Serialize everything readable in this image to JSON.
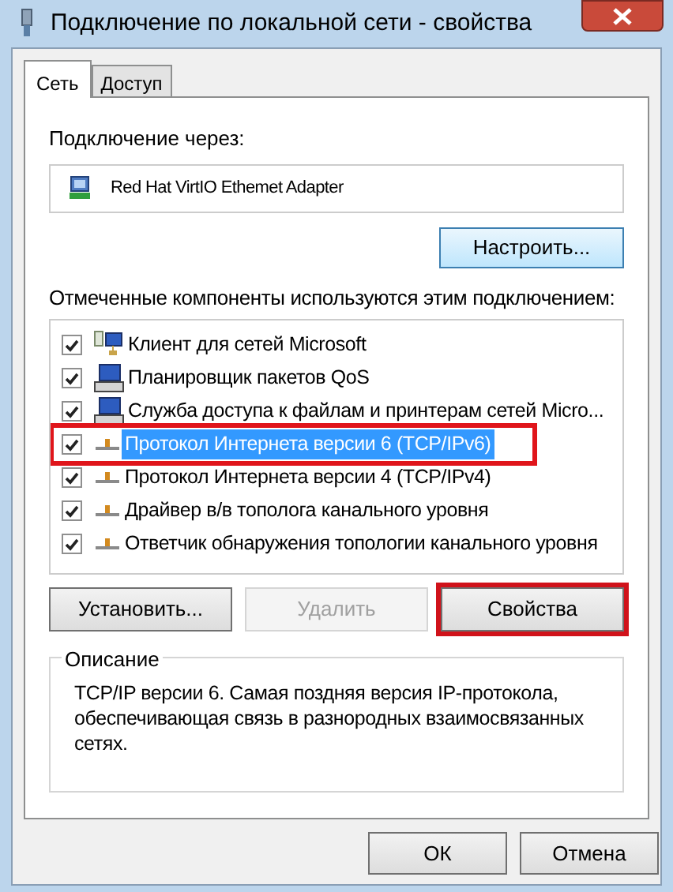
{
  "window": {
    "title": "Подключение по локальной сети - свойства"
  },
  "tabs": [
    {
      "label": "Сеть",
      "selected": true
    },
    {
      "label": "Доступ",
      "selected": false
    }
  ],
  "connect_label": "Подключение через:",
  "adapter": "Red Hat VirtIO Ethemet Adapter",
  "configure_button": "Настроить...",
  "components_label": "Отмеченные компоненты используются этим подключением:",
  "components": [
    {
      "kind": "client",
      "label": "Клиент для сетей Microsoft",
      "checked": true,
      "selected": false,
      "highlighted": false
    },
    {
      "kind": "service",
      "label": "Планировщик пакетов QoS",
      "checked": true,
      "selected": false,
      "highlighted": false
    },
    {
      "kind": "service",
      "label": "Служба доступа к файлам и принтерам сетей Micro...",
      "checked": true,
      "selected": false,
      "highlighted": false
    },
    {
      "kind": "protocol",
      "label": "Протокол Интернета версии 6 (TCP/IPv6)",
      "checked": true,
      "selected": true,
      "highlighted": true
    },
    {
      "kind": "protocol",
      "label": "Протокол Интернета версии 4 (TCP/IPv4)",
      "checked": true,
      "selected": false,
      "highlighted": false
    },
    {
      "kind": "protocol",
      "label": "Драйвер в/в тополога канального уровня",
      "checked": true,
      "selected": false,
      "highlighted": false
    },
    {
      "kind": "protocol",
      "label": "Ответчик обнаружения топологии канального уровня",
      "checked": true,
      "selected": false,
      "highlighted": false
    }
  ],
  "actions": [
    {
      "label": "Установить...",
      "disabled": false,
      "highlighted": false
    },
    {
      "label": "Удалить",
      "disabled": true,
      "highlighted": false
    },
    {
      "label": "Свойства",
      "disabled": false,
      "highlighted": true
    }
  ],
  "description": {
    "title": "Описание",
    "text": "TCP/IP версии 6. Самая поздняя версия IP-протокола, обеспечивающая связь в разнородных взаимосвязанных сетях."
  },
  "buttons": [
    "ОК",
    "Отмена"
  ]
}
